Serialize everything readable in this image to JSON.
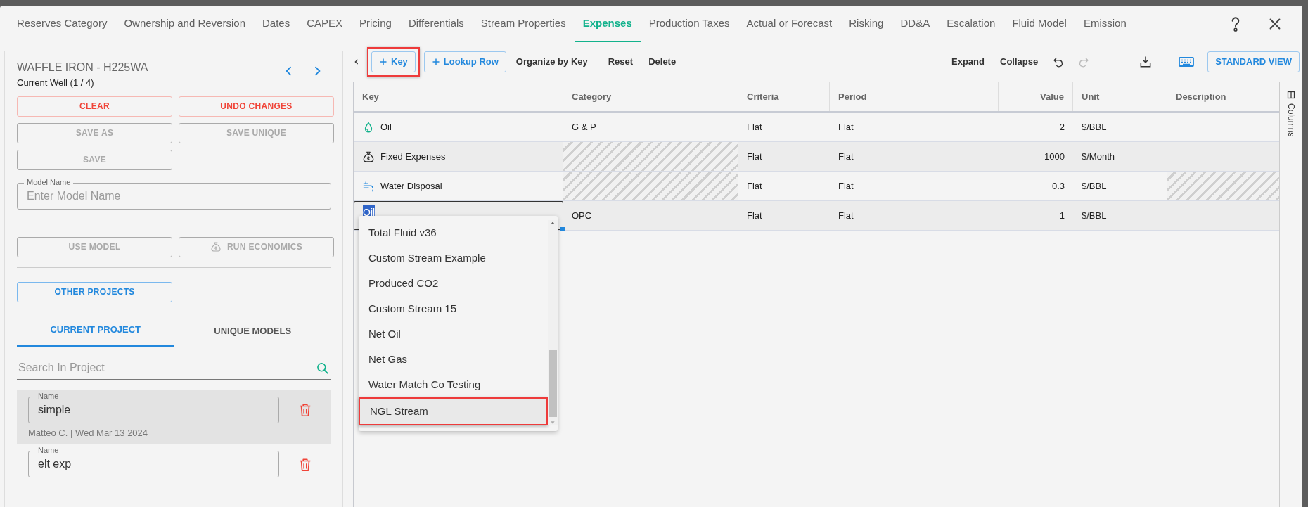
{
  "tabs": [
    {
      "label": "Reserves Category",
      "selected": false
    },
    {
      "label": "Ownership and Reversion",
      "selected": false
    },
    {
      "label": "Dates",
      "selected": false
    },
    {
      "label": "CAPEX",
      "selected": false
    },
    {
      "label": "Pricing",
      "selected": false
    },
    {
      "label": "Differentials",
      "selected": false
    },
    {
      "label": "Stream Properties",
      "selected": false
    },
    {
      "label": "Expenses",
      "selected": true
    },
    {
      "label": "Production Taxes",
      "selected": false
    },
    {
      "label": "Actual or Forecast",
      "selected": false
    },
    {
      "label": "Risking",
      "selected": false
    },
    {
      "label": "DD&A",
      "selected": false
    },
    {
      "label": "Escalation",
      "selected": false
    },
    {
      "label": "Fluid Model",
      "selected": false
    },
    {
      "label": "Emission",
      "selected": false
    }
  ],
  "left_panel": {
    "well_name": "WAFFLE IRON - H225WA",
    "well_position": "Current Well (1 / 4)",
    "button_rows": [
      [
        {
          "label": "CLEAR",
          "kind": "danger",
          "disabled": false
        },
        {
          "label": "UNDO CHANGES",
          "kind": "danger",
          "disabled": false
        }
      ],
      [
        {
          "label": "SAVE AS",
          "kind": "plain",
          "disabled": true
        },
        {
          "label": "SAVE UNIQUE",
          "kind": "plain",
          "disabled": true
        }
      ],
      [
        {
          "label": "SAVE",
          "kind": "plain",
          "disabled": true
        }
      ]
    ],
    "model_name": {
      "label": "Model Name",
      "placeholder": "Enter Model Name"
    },
    "model_buttons": [
      {
        "label": "USE MODEL",
        "kind": "plain",
        "disabled": true
      },
      {
        "label": "RUN ECONOMICS",
        "kind": "run",
        "disabled": true
      }
    ],
    "project_button": {
      "label": "OTHER PROJECTS",
      "kind": "primary",
      "disabled": false
    },
    "project_tabs": [
      {
        "label": "CURRENT PROJECT",
        "selected": true
      },
      {
        "label": "UNIQUE MODELS",
        "selected": false
      }
    ],
    "search": {
      "placeholder": "Search In Project"
    },
    "models": [
      {
        "label": "Name",
        "value": "simple",
        "meta": "Matteo C. | Wed Mar 13 2024",
        "selected": true
      },
      {
        "label": "Name",
        "value": "elt exp",
        "selected": false
      }
    ]
  },
  "toolbar": {
    "add_buttons": [
      {
        "label": "Key",
        "highlighted": true
      },
      {
        "label": "Lookup Row",
        "highlighted": false
      }
    ],
    "actions": [
      "Organize by Key",
      "Reset",
      "Delete"
    ],
    "right_actions": [
      "Expand",
      "Collapse"
    ],
    "history": [
      {
        "kind": "undo",
        "disabled": false
      },
      {
        "kind": "redo",
        "disabled": true
      }
    ],
    "view_button": "STANDARD VIEW"
  },
  "table": {
    "columns": [
      "Key",
      "Category",
      "Criteria",
      "Period",
      "Value",
      "Unit",
      "Description"
    ],
    "rows": [
      {
        "kind": "product",
        "key": "Oil",
        "category": "G & P",
        "category_disabled": false,
        "criteria": "Flat",
        "period": "Flat",
        "value": "2",
        "unit": "$/BBL",
        "description_disabled": false
      },
      {
        "kind": "fixed",
        "key": "Fixed Expenses",
        "category_disabled": true,
        "criteria": "Flat",
        "period": "Flat",
        "value": "1000",
        "unit": "$/Month",
        "description_disabled": false
      },
      {
        "kind": "disposal",
        "key": "Water Disposal",
        "category_disabled": true,
        "criteria": "Flat",
        "period": "Flat",
        "value": "0.3",
        "unit": "$/BBL",
        "description_disabled": true
      },
      {
        "kind": "editing",
        "key": "Oil",
        "category": "OPC",
        "category_disabled": false,
        "criteria": "Flat",
        "period": "Flat",
        "value": "1",
        "unit": "$/BBL",
        "description_disabled": false
      }
    ]
  },
  "dropdown": {
    "items": [
      {
        "label": "Total Fluid v36",
        "highlighted": false
      },
      {
        "label": "Custom Stream Example",
        "highlighted": false
      },
      {
        "label": "Produced CO2",
        "highlighted": false
      },
      {
        "label": "Custom Stream 15",
        "highlighted": false
      },
      {
        "label": "Net Oil",
        "highlighted": false
      },
      {
        "label": "Net Gas",
        "highlighted": false
      },
      {
        "label": "Water Match Co Testing",
        "highlighted": false
      },
      {
        "label": "NGL Stream",
        "highlighted": true
      }
    ]
  },
  "columns_panel": {
    "label": "Columns"
  }
}
